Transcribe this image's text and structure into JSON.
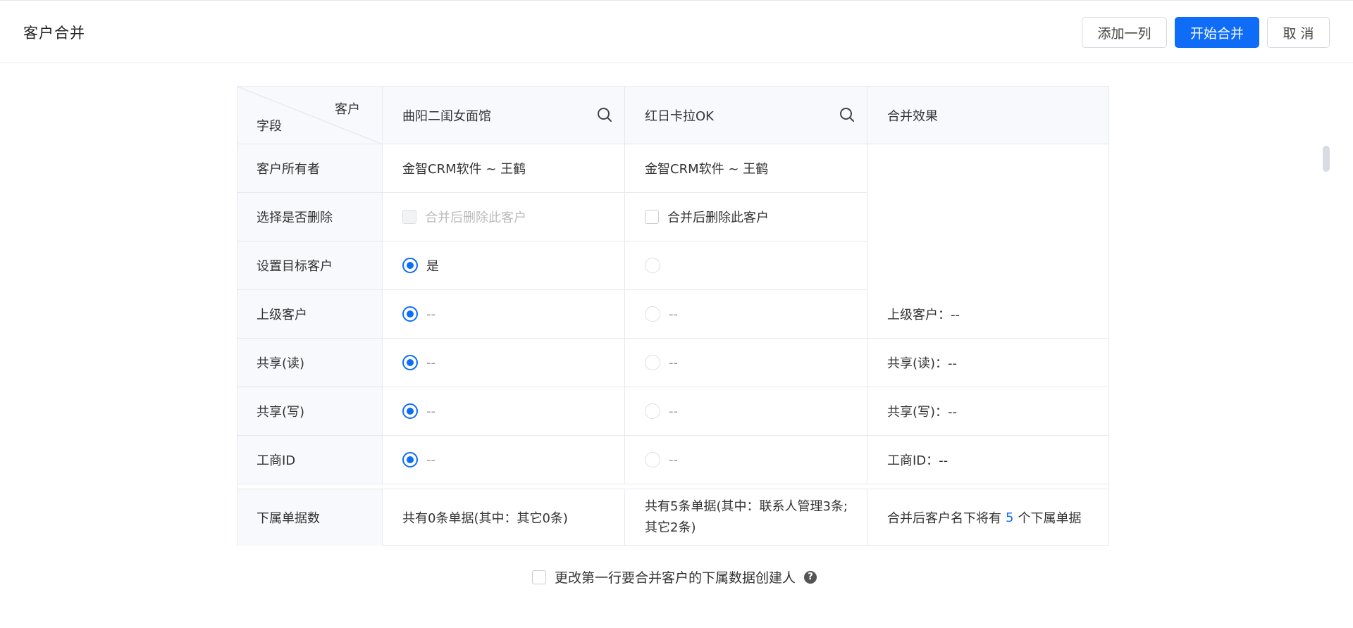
{
  "header": {
    "title": "客户合并",
    "buttons": {
      "add_column": "添加一列",
      "start_merge": "开始合并",
      "cancel": "取 消"
    }
  },
  "table": {
    "corner": {
      "top": "客户",
      "bottom": "字段"
    },
    "columns": [
      "曲阳二闺女面馆",
      "红日卡拉OK",
      "合并效果"
    ],
    "rows": {
      "owner": {
        "label": "客户所有者",
        "c1": "金智CRM软件 ~ 王鹤",
        "c2": "金智CRM软件 ~ 王鹤"
      },
      "delete": {
        "label": "选择是否删除",
        "c1": "合并后删除此客户",
        "c2": "合并后删除此客户"
      },
      "target": {
        "label": "设置目标客户",
        "c1": "是"
      },
      "parent": {
        "label": "上级客户",
        "c1": "--",
        "c2": "--",
        "c3": "上级客户：--"
      },
      "share_read": {
        "label": "共享(读)",
        "c1": "--",
        "c2": "--",
        "c3": "共享(读)：--"
      },
      "share_write": {
        "label": "共享(写)",
        "c1": "--",
        "c2": "--",
        "c3": "共享(写)：--"
      },
      "biz_id": {
        "label": "工商ID",
        "c1": "--",
        "c2": "--",
        "c3": "工商ID：--"
      },
      "sub_docs": {
        "label": "下属单据数",
        "c1": "共有0条单据(其中：其它0条)",
        "c2_line1": "共有5条单据(其中：联系人管理3条;",
        "c2_line2": "其它2条)",
        "c3_prefix": "合并后客户名下将有",
        "c3_count": "5",
        "c3_suffix": "个下属单据"
      }
    }
  },
  "bottom_option": {
    "label": "更改第一行要合并客户的下属数据创建人",
    "help": "?"
  },
  "colors": {
    "primary": "#0f6cf7",
    "header_bg": "#f7f9fc",
    "border": "#e6e9ef"
  }
}
